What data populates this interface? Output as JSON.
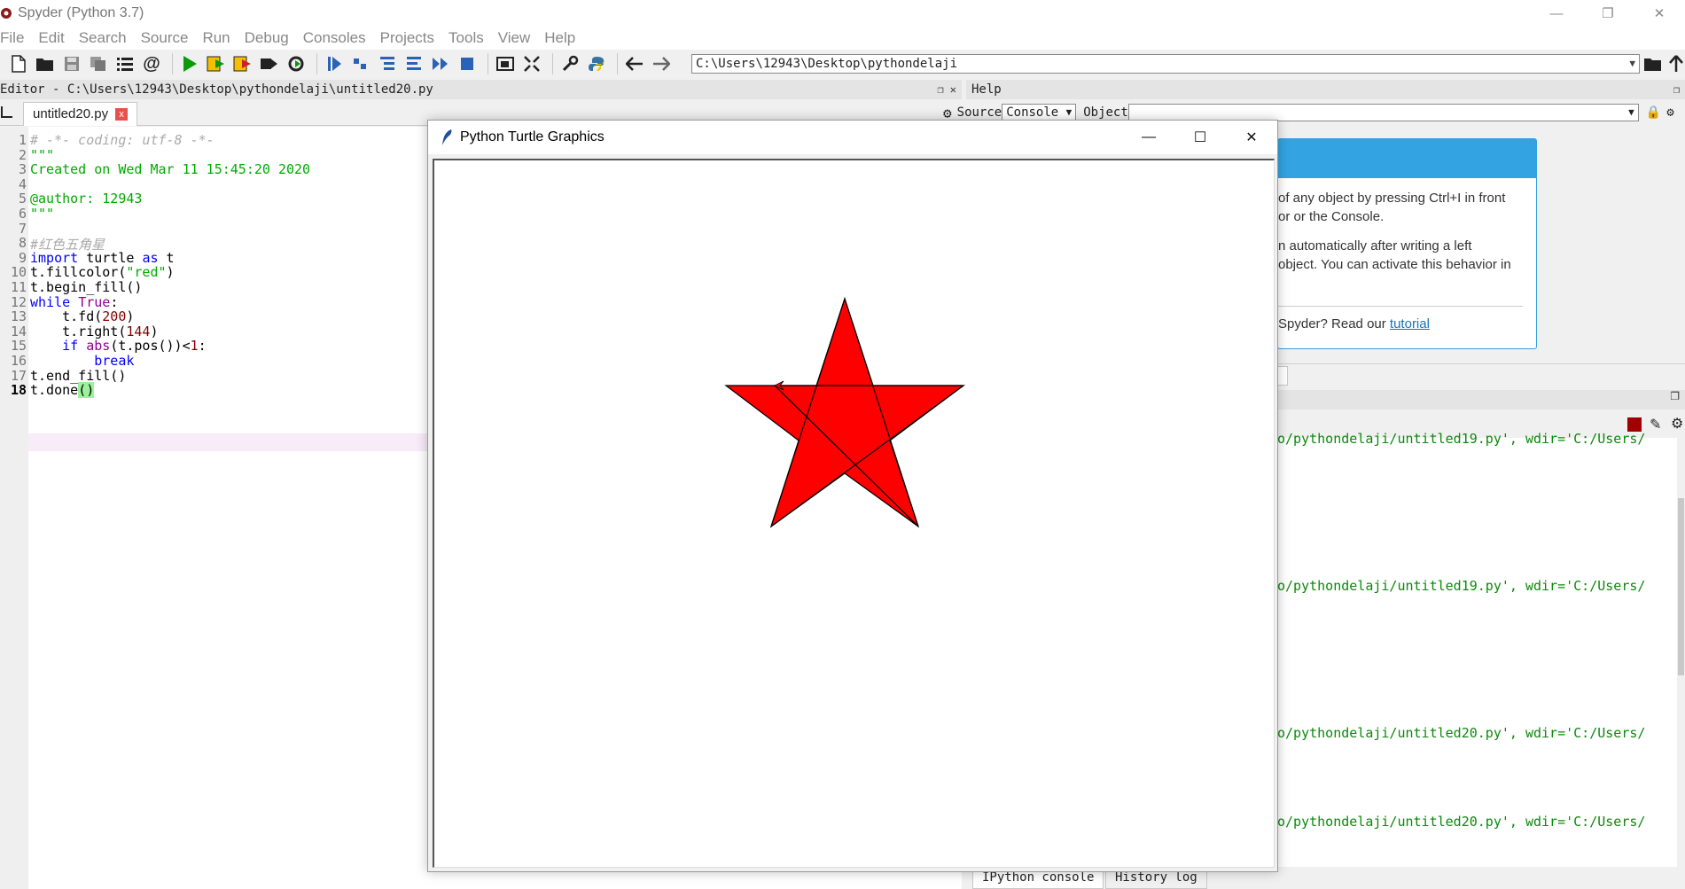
{
  "app": {
    "title": "Spyder (Python 3.7)"
  },
  "menu": [
    "File",
    "Edit",
    "Search",
    "Source",
    "Run",
    "Debug",
    "Consoles",
    "Projects",
    "Tools",
    "View",
    "Help"
  ],
  "toolbar": {
    "working_dir": "C:\\Users\\12943\\Desktop\\pythondelaji"
  },
  "editor": {
    "header": "Editor - C:\\Users\\12943\\Desktop\\pythondelaji\\untitled20.py",
    "tab_label": "untitled20.py",
    "tab_close": "x",
    "current_line": 18,
    "lines": [
      "# -*- coding: utf-8 -*-",
      "\"\"\"",
      "Created on Wed Mar 11 15:45:20 2020",
      "",
      "@author: 12943",
      "\"\"\"",
      "",
      "#红色五角星",
      "import turtle as t",
      "t.fillcolor(\"red\")",
      "t.begin_fill()",
      "while True:",
      "    t.fd(200)",
      "    t.right(144)",
      "    if abs(t.pos())<1:",
      "        break",
      "t.end_fill()",
      "t.done()"
    ]
  },
  "help": {
    "header": "Help",
    "source_label": "Source",
    "source_value": "Console",
    "object_label": "Object",
    "object_value": "",
    "text_1": "of any object by pressing Ctrl+I in front",
    "text_2": "or or the Console.",
    "text_3": "n automatically after writing a left",
    "text_4": "object. You can activate this behavior in",
    "text_5_prefix": "Spyder? Read our ",
    "text_5_link": "tutorial"
  },
  "console": {
    "lines": [
      "o/pythondelaji/untitled19.py', wdir='C:/Users/",
      "o/pythondelaji/untitled19.py', wdir='C:/Users/",
      "o/pythondelaji/untitled20.py', wdir='C:/Users/",
      "o/pythondelaji/untitled20.py', wdir='C:/Users/"
    ],
    "tabs": [
      "IPython console",
      "History log"
    ]
  },
  "turtle_window": {
    "title": "Python Turtle Graphics",
    "fill_color": "#ff0000",
    "stroke_color": "#000000",
    "shape": "five-pointed star",
    "step": 200,
    "turn_angle": 144
  },
  "colors": {
    "keyword": "#0000ff",
    "string": "#00aa00",
    "comment": "#aaaaaa",
    "number": "#800000",
    "accent": "#33a3e1"
  }
}
